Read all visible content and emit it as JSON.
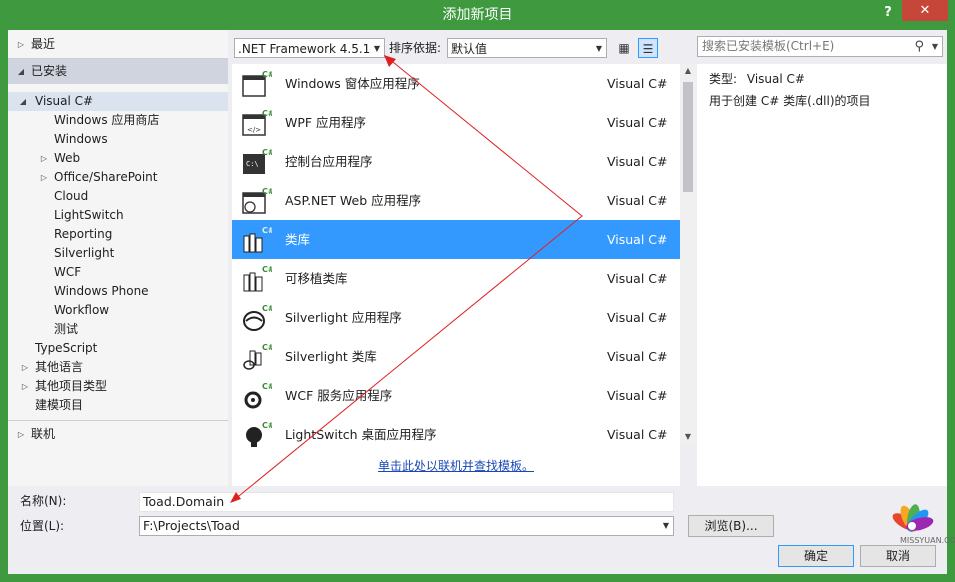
{
  "window": {
    "title": "添加新项目",
    "help_label": "?",
    "close_label": "✕"
  },
  "tree": {
    "recent": "最近",
    "installed": "已安装",
    "visual_csharp": "Visual C#",
    "children": [
      "Windows 应用商店",
      "Windows",
      "Web",
      "Office/SharePoint",
      "Cloud",
      "LightSwitch",
      "Reporting",
      "Silverlight",
      "WCF",
      "Windows Phone",
      "Workflow",
      "测试"
    ],
    "typescript": "TypeScript",
    "other_languages": "其他语言",
    "other_project_types": "其他项目类型",
    "modeling": "建模项目",
    "online": "联机"
  },
  "toolbar": {
    "framework": ".NET Framework 4.5.1",
    "sort_label": "排序依据:",
    "sort_value": "默认值"
  },
  "templates": [
    {
      "name": "Windows 窗体应用程序",
      "lang": "Visual C#",
      "icon": "winforms-icon"
    },
    {
      "name": "WPF 应用程序",
      "lang": "Visual C#",
      "icon": "wpf-icon"
    },
    {
      "name": "控制台应用程序",
      "lang": "Visual C#",
      "icon": "console-icon"
    },
    {
      "name": "ASP.NET Web 应用程序",
      "lang": "Visual C#",
      "icon": "web-app-icon"
    },
    {
      "name": "类库",
      "lang": "Visual C#",
      "icon": "class-library-icon",
      "selected": true
    },
    {
      "name": "可移植类库",
      "lang": "Visual C#",
      "icon": "portable-library-icon"
    },
    {
      "name": "Silverlight 应用程序",
      "lang": "Visual C#",
      "icon": "silverlight-app-icon"
    },
    {
      "name": "Silverlight 类库",
      "lang": "Visual C#",
      "icon": "silverlight-library-icon"
    },
    {
      "name": "WCF 服务应用程序",
      "lang": "Visual C#",
      "icon": "wcf-service-icon"
    },
    {
      "name": "LightSwitch 桌面应用程序",
      "lang": "Visual C#",
      "icon": "lightswitch-icon"
    }
  ],
  "online_link": "单击此处以联机并查找模板。",
  "search": {
    "placeholder": "搜索已安装模板(Ctrl+E)"
  },
  "details": {
    "type_label": "类型:",
    "type_value": "Visual C#",
    "description": "用于创建 C# 类库(.dll)的项目"
  },
  "form": {
    "name_label": "名称(N):",
    "name_value": "Toad.Domain",
    "location_label": "位置(L):",
    "location_value": "F:\\Projects\\Toad",
    "browse_label": "浏览(B)...",
    "ok_label": "确定",
    "cancel_label": "取消"
  },
  "watermark": "MISSYUAN.COM",
  "colors": {
    "titlebar": "#3f9a3f",
    "selection": "#3399ff",
    "close": "#c7463a",
    "arrow": "#e02020"
  }
}
